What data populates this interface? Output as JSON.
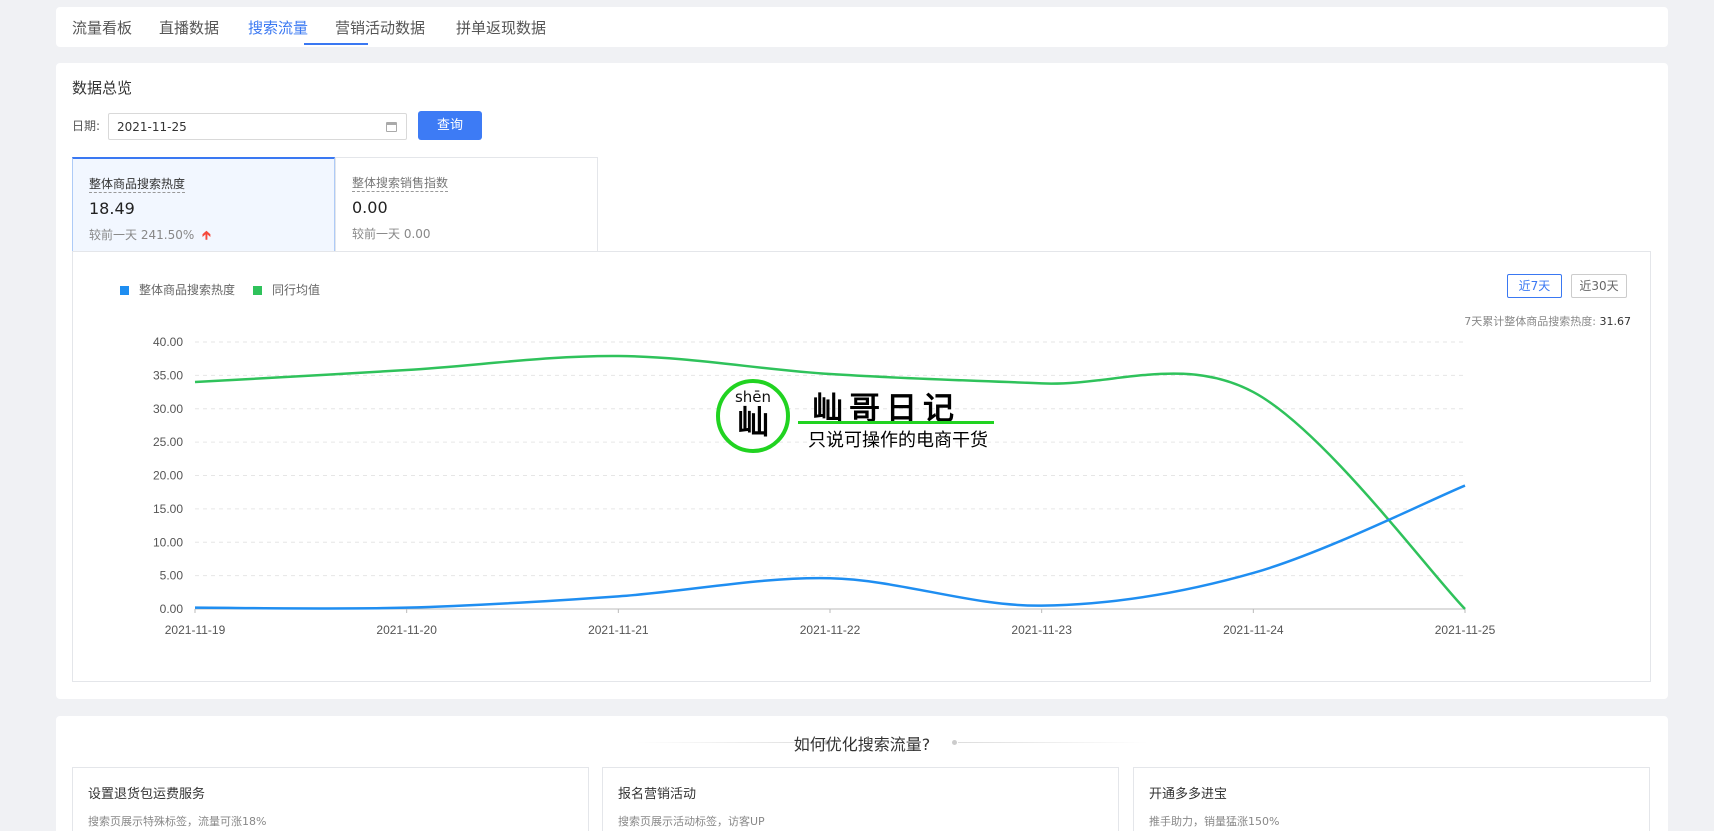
{
  "tabs": [
    {
      "label": "流量看板",
      "active": false
    },
    {
      "label": "直播数据",
      "active": false
    },
    {
      "label": "搜索流量",
      "active": true
    },
    {
      "label": "营销活动数据",
      "active": false
    },
    {
      "label": "拼单返现数据",
      "active": false
    }
  ],
  "overview": {
    "title": "数据总览",
    "date_label": "日期:",
    "date_value": "2021-11-25",
    "query_button": "查询"
  },
  "metrics": [
    {
      "title": "整体商品搜索热度",
      "value": "18.49",
      "compare_label": "较前一天",
      "compare_value": "241.50%",
      "trend": "up"
    },
    {
      "title": "整体搜索销售指数",
      "value": "0.00",
      "compare_label": "较前一天",
      "compare_value": "0.00",
      "trend": "none"
    }
  ],
  "chart_controls": {
    "range_7": "近7天",
    "range_30": "近30天",
    "cumulative_label": "7天累计整体商品搜索热度:",
    "cumulative_value": "31.67"
  },
  "chart_data": {
    "type": "line",
    "smooth": true,
    "x": [
      "2021-11-19",
      "2021-11-20",
      "2021-11-21",
      "2021-11-22",
      "2021-11-23",
      "2021-11-24",
      "2021-11-25"
    ],
    "ylim": [
      0,
      40
    ],
    "yticks": [
      "0.00",
      "5.00",
      "10.00",
      "15.00",
      "20.00",
      "25.00",
      "30.00",
      "35.00",
      "40.00"
    ],
    "grid": "dashed horizontal",
    "legend_position": "top-left",
    "series": [
      {
        "name": "整体商品搜索热度",
        "color": "#1f8ef1",
        "values": [
          0.2,
          0.2,
          1.9,
          4.6,
          0.5,
          5.4,
          18.49
        ]
      },
      {
        "name": "同行均值",
        "color": "#2fc25b",
        "values": [
          34.0,
          35.8,
          37.9,
          35.2,
          33.8,
          32.5,
          0.0
        ]
      }
    ]
  },
  "watermark": {
    "pinyin": "shēn",
    "char": "屾",
    "name": "屾哥日记",
    "slogan": "只说可操作的电商干货"
  },
  "tips": {
    "title": "如何优化搜索流量?",
    "items": [
      {
        "title": "设置退货包运费服务",
        "desc": "搜索页展示特殊标签，流量可涨18%"
      },
      {
        "title": "报名营销活动",
        "desc": "搜索页展示活动标签，访客UP"
      },
      {
        "title": "开通多多进宝",
        "desc": "推手助力，销量猛涨150%"
      }
    ]
  }
}
